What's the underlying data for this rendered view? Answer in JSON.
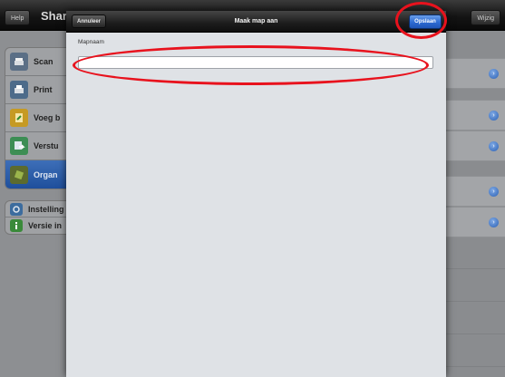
{
  "background_app": {
    "title": "Sharp",
    "help_label": "Help",
    "edit_label": "Wijzig",
    "menu": [
      {
        "label": "Scan",
        "icon": "scan-icon",
        "color": "#5b6f86"
      },
      {
        "label": "Print",
        "icon": "print-icon",
        "color": "#4d6b8a"
      },
      {
        "label": "Voeg b",
        "icon": "add-file-icon",
        "color": "#c69a23"
      },
      {
        "label": "Verstu",
        "icon": "send-icon",
        "color": "#3d8e54"
      },
      {
        "label": "Organ",
        "icon": "organize-icon",
        "color": "#5c6b2e",
        "selected": true
      }
    ],
    "menu_small": [
      {
        "label": "Instelling",
        "icon": "settings-icon",
        "color": "#3c6c9e"
      },
      {
        "label": "Versie in",
        "icon": "info-icon",
        "color": "#3a8a3a"
      }
    ],
    "chevron_glyph": "›"
  },
  "dialog": {
    "cancel_label": "Annuleer",
    "title": "Maak map aan",
    "save_label": "Opslaan",
    "field_label": "Mapnaam",
    "field_value": "",
    "field_placeholder": ""
  },
  "annotation_color": "#e8121d"
}
